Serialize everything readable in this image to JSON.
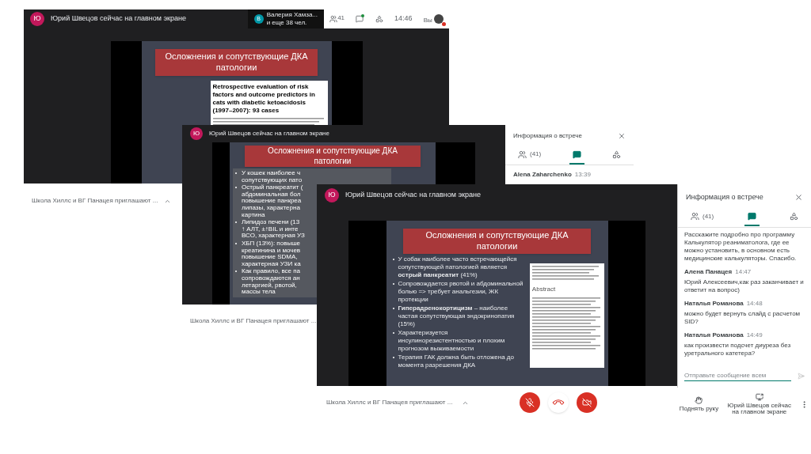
{
  "back_window": {
    "presenter": {
      "avatar": "Ю",
      "title": "Юрий Швецов сейчас на главном экране"
    },
    "participants": {
      "avatar": "В",
      "name": "Валерия Хамза...",
      "more": "и еще 38 чел."
    },
    "toolbar": {
      "people_count": "41",
      "chat_unread": true,
      "time": "14:46",
      "self_label": "Вы",
      "self_alert": true
    },
    "slide": {
      "title": "Осложнения и сопутствующие ДКА патологии",
      "paper_title": "Retrospective evaluation of risk factors and outcome predictors in cats with diabetic ketoacidosis (1997–2007): 93 cases"
    },
    "meeting_name": "Школа Хиллс и ВГ Панацея приглашают ..."
  },
  "middle_window": {
    "presenter": {
      "avatar": "Ю",
      "title": "Юрий Швецов сейчас на главном экране"
    },
    "slide": {
      "title": "Осложнения и сопутствующие ДКА патологии",
      "bullets": [
        [
          "У кошек наиболее ч",
          "сопутствующих пато"
        ],
        [
          "Острый панкреатит (",
          "абдоминальная бол",
          "повышение панкреа",
          "липазы, характерна",
          "картина"
        ],
        [
          "Липидоз печени (13",
          "↑ АЛТ, ±↑BIL и инте",
          "ВСО, характерная УЗ"
        ],
        [
          "ХБП (13%): повыше",
          "креатинина и мочев",
          "повышение SDMA, ",
          "характерная УЗИ ка"
        ],
        [
          "Как правило, все па",
          "сопровождаются ан",
          "летаргией, рвотой, ",
          "массы тела"
        ]
      ]
    },
    "meeting_name": "Школа Хиллс и ВГ Панацея приглашают ...",
    "panel": {
      "title": "Информация о встрече",
      "tabs": [
        {
          "kind": "people",
          "label": "(41)",
          "selected": false
        },
        {
          "kind": "chat",
          "selected": true
        },
        {
          "kind": "activities",
          "selected": false
        }
      ],
      "message": {
        "author": "Alena Zaharchenko",
        "time": "13:39"
      }
    }
  },
  "front_window": {
    "presenter": {
      "avatar": "Ю",
      "title": "Юрий Швецов сейчас на главном экране"
    },
    "slide": {
      "title": "Осложнения и сопутствующие ДКА патологии",
      "bullets": [
        "У собак наиболее часто встречающейся сопутствующей патологией является **острый панкреатит** (41%)",
        "Сопровождается рвотой и абдоминальной болью => требует анальгезии, ЖК протекции",
        "**Гиперадренокортицизм** – наиболее частая сопутствующая эндокринопатия (15%)",
        "Характеризуется инсулинорезистентностью и плохим прогнозом выживаемости",
        "Терапия ГАК должна быть отложена до момента разрешения ДКА"
      ],
      "paper_heading": "Abstract"
    },
    "meeting_name": "Школа Хиллс и ВГ Панацея приглашают ...",
    "controls": [
      {
        "kind": "mic",
        "on": false
      },
      {
        "kind": "hangup"
      },
      {
        "kind": "camera",
        "on": false
      }
    ],
    "panel": {
      "title": "Информация о встрече",
      "tabs": [
        {
          "kind": "people",
          "label": "(41)",
          "selected": false
        },
        {
          "kind": "chat",
          "selected": true
        },
        {
          "kind": "activities",
          "selected": false
        }
      ],
      "messages": [
        {
          "text": "Расскажите подробно про программу Калькулятор реаниматолога, где ее можно установить, в основном есть медицинские калькуляторы. Спасибо."
        },
        {
          "author": "Алена Панацея",
          "time": "14:47",
          "text": "Юрий Алексеевич,как раз заканчивает и ответит на вопрос)"
        },
        {
          "author": "Наталья Романова",
          "time": "14:48",
          "text": "можно будет вернуть слайд с расчетом SID?"
        },
        {
          "author": "Наталья Романова",
          "time": "14:49",
          "text": "как произвести подсчет диуреза без уретрального катетера?"
        }
      ],
      "input_placeholder": "Отправьте сообщение всем"
    },
    "actions": [
      {
        "kind": "raise_hand",
        "label": "Поднять руку"
      },
      {
        "kind": "presenting",
        "label": "Юрий Швецов сейчас на главном экране"
      },
      {
        "kind": "more"
      }
    ]
  }
}
